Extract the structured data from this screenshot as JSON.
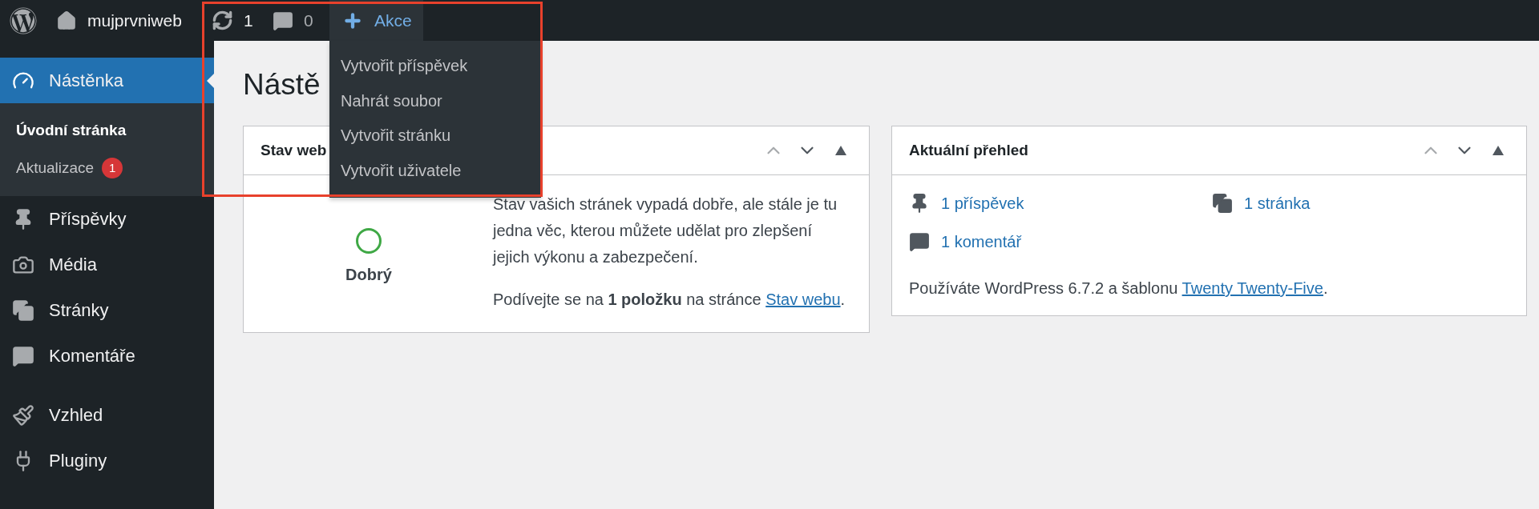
{
  "admin_bar": {
    "site_name": "mujprvniweb",
    "updates": "1",
    "comments": "0",
    "new_label": "Akce",
    "new_open": true
  },
  "new_menu": [
    "Vytvořit příspěvek",
    "Nahrát soubor",
    "Vytvořit stránku",
    "Vytvořit uživatele"
  ],
  "sidebar": {
    "items": [
      {
        "label": "Nástěnka",
        "kind": "dashboard",
        "selected": true,
        "children": [
          {
            "label": "Úvodní stránka",
            "selected": true
          },
          {
            "label": "Aktualizace",
            "badge": "1",
            "selected": false
          }
        ]
      },
      {
        "label": "Příspěvky",
        "kind": "posts",
        "selected": false
      },
      {
        "label": "Média",
        "kind": "media",
        "selected": false
      },
      {
        "label": "Stránky",
        "kind": "pages",
        "selected": false
      },
      {
        "label": "Komentáře",
        "kind": "comments",
        "selected": false
      },
      {
        "label": "Vzhled",
        "kind": "appearance",
        "selected": false,
        "gap_before": true
      },
      {
        "label": "Pluginy",
        "kind": "plugins",
        "selected": false
      }
    ]
  },
  "page_title": "Nástě",
  "site_health": {
    "title": "Stav web",
    "status": "Dobrý",
    "text": "Stav vašich stránek vypadá dobře, ale stále je tu jedna věc, kterou můžete udělat pro zlepšení jejich výkonu a zabezpečení.",
    "cta": "Podívejte se na **1 položku** na stránce ",
    "link": "Stav webu",
    "cta_after": "."
  },
  "at_a_glance": {
    "title": "Aktuální přehled",
    "items": [
      {
        "kind": "posts",
        "label": "1 příspěvek"
      },
      {
        "kind": "pages",
        "label": "1 stránka"
      },
      {
        "kind": "comments",
        "label": "1 komentář"
      }
    ],
    "version_text": "Používáte WordPress 6.7.2 a šablonu ",
    "theme_link": "Twenty Twenty-Five",
    "after": "."
  }
}
